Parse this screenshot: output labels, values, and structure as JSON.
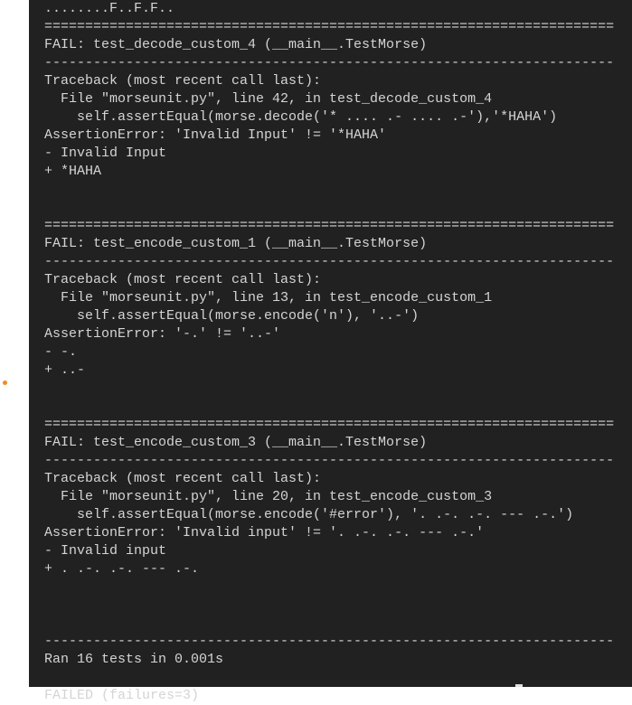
{
  "indicator_color": "#f08a24",
  "output": {
    "lines": [
      "........F..F.F..",
      "======================================================================",
      "FAIL: test_decode_custom_4 (__main__.TestMorse)",
      "----------------------------------------------------------------------",
      "Traceback (most recent call last):",
      "  File \"morseunit.py\", line 42, in test_decode_custom_4",
      "    self.assertEqual(morse.decode('* .... .- .... .-'),'*HAHA')",
      "AssertionError: 'Invalid Input' != '*HAHA'",
      "- Invalid Input",
      "+ *HAHA",
      "",
      "",
      "======================================================================",
      "FAIL: test_encode_custom_1 (__main__.TestMorse)",
      "----------------------------------------------------------------------",
      "Traceback (most recent call last):",
      "  File \"morseunit.py\", line 13, in test_encode_custom_1",
      "    self.assertEqual(morse.encode('n'), '..-')",
      "AssertionError: '-.' != '..-'",
      "- -.",
      "+ ..-",
      "",
      "",
      "======================================================================",
      "FAIL: test_encode_custom_3 (__main__.TestMorse)",
      "----------------------------------------------------------------------",
      "Traceback (most recent call last):",
      "  File \"morseunit.py\", line 20, in test_encode_custom_3",
      "    self.assertEqual(morse.encode('#error'), '. .-. .-. --- .-.')",
      "AssertionError: 'Invalid input' != '. .-. .-. --- .-.'",
      "- Invalid input",
      "+ . .-. .-. --- .-.",
      "",
      "",
      "",
      "----------------------------------------------------------------------",
      "Ran 16 tests in 0.001s",
      "",
      "FAILED (failures=3)"
    ]
  }
}
